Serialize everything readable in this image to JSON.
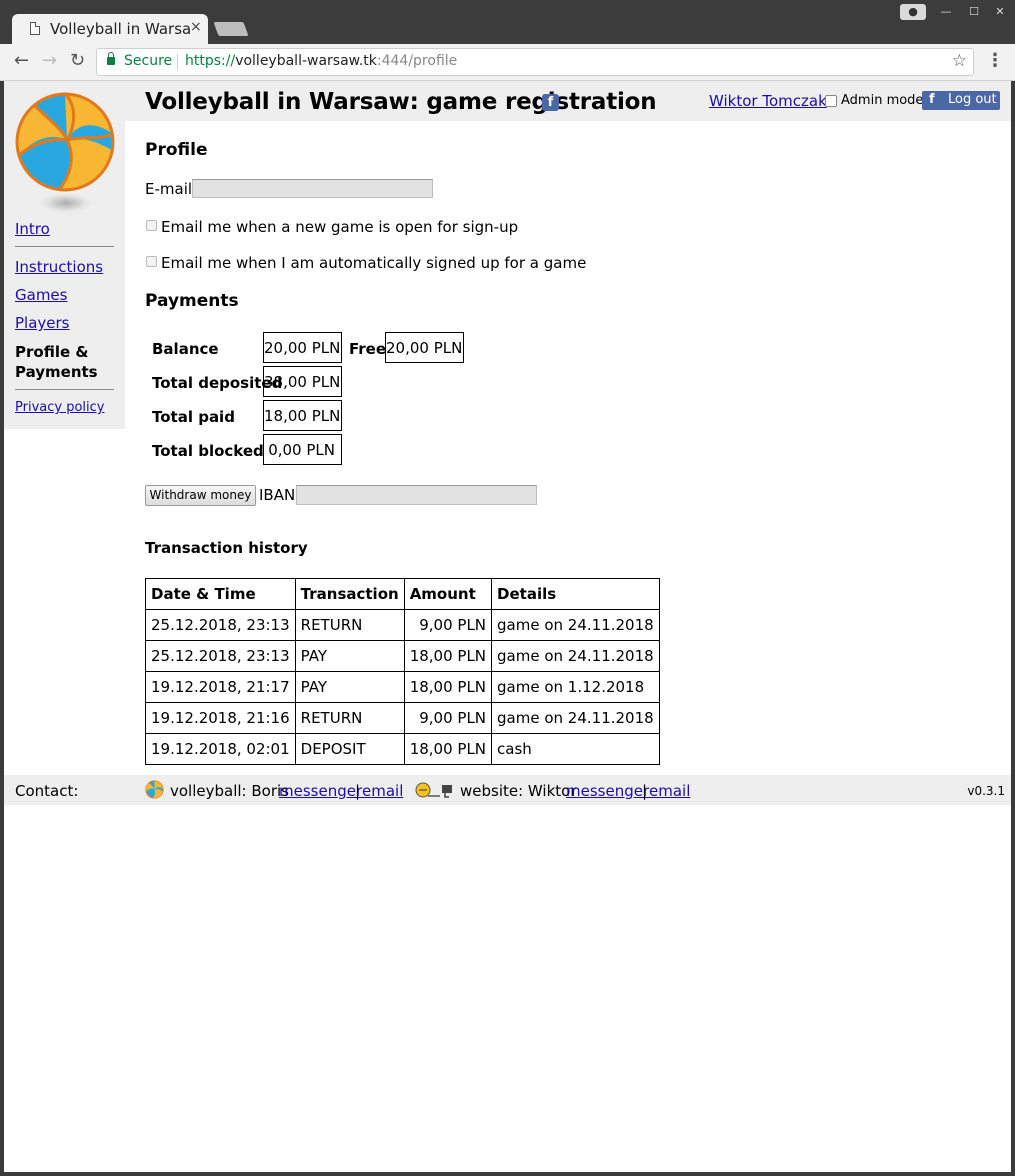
{
  "browser": {
    "tab_title": "Volleyball in Warsaw: game registration",
    "tab_close": "×",
    "secure_label": "Secure",
    "url_scheme": "https://",
    "url_host": "volleyball-warsaw.tk",
    "url_rest": ":444/profile",
    "icons": {
      "back": "←",
      "forward": "→",
      "reload": "↻",
      "star": "☆",
      "menu": "⋮",
      "minimize": "—",
      "maximize": "☐",
      "close": "✕",
      "profile": "●"
    }
  },
  "header": {
    "title": "Volleyball in Warsaw: game registration",
    "fb_glyph": "f",
    "user_name": "Wiktor Tomczak",
    "admin_mode_label": "Admin mode",
    "logout_glyph": "f",
    "logout_label": "Log out",
    "brand_color": "#4a67a6"
  },
  "sidebar": {
    "intro": "Intro",
    "instructions": "Instructions",
    "games": "Games",
    "players": "Players",
    "current_line1": "Profile &",
    "current_line2": "Payments",
    "privacy": "Privacy policy"
  },
  "profile": {
    "heading": "Profile",
    "email_label": "E-mail",
    "email_value": "",
    "option_new_game": "Email me when a new game is open for sign-up",
    "option_auto_signup": "Email me when I am automatically signed up for a game"
  },
  "payments": {
    "heading": "Payments",
    "balance_label": "Balance",
    "balance_value": "20,00 PLN",
    "free_label": "Free",
    "free_value": "20,00 PLN",
    "deposited_label": "Total deposited",
    "deposited_value": "38,00 PLN",
    "paid_label": "Total paid",
    "paid_value": "18,00 PLN",
    "blocked_label": "Total blocked",
    "blocked_value": "0,00 PLN",
    "withdraw_label": "Withdraw money",
    "iban_label": "IBAN",
    "iban_value": ""
  },
  "transactions": {
    "title": "Transaction history",
    "columns": [
      "Date & Time",
      "Transaction",
      "Amount",
      "Details"
    ],
    "rows": [
      [
        "25.12.2018, 23:13",
        "RETURN",
        "9,00 PLN",
        "game on 24.11.2018"
      ],
      [
        "25.12.2018, 23:13",
        "PAY",
        "18,00 PLN",
        "game on 24.11.2018"
      ],
      [
        "19.12.2018, 21:17",
        "PAY",
        "18,00 PLN",
        "game on 1.12.2018"
      ],
      [
        "19.12.2018, 21:16",
        "RETURN",
        "9,00 PLN",
        "game on 24.11.2018"
      ],
      [
        "19.12.2018, 02:01",
        "DEPOSIT",
        "18,00 PLN",
        "cash"
      ]
    ]
  },
  "footer": {
    "contact_label": "Contact:",
    "volleyball_text": "volleyball: Boris",
    "messenger_label": "messenger",
    "sep": "|",
    "email_label": "email",
    "website_text": "website: Wiktor",
    "messenger_label_2": "messenger",
    "email_label_2": "email",
    "version": "v0.3.1"
  }
}
